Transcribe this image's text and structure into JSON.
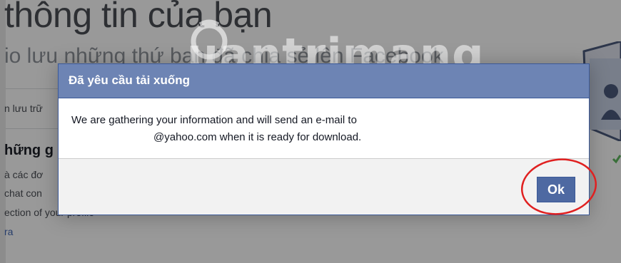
{
  "background": {
    "title": "thông tin của bạn",
    "subtitle": "io lưu những thứ bạn đã chia sẻ lên Facebook",
    "section_label": "n lưu trữ",
    "section_heading": "hững g",
    "lines": [
      "à các đơ",
      "chat con",
      "ection of your profile"
    ],
    "link": "ra"
  },
  "watermark": {
    "text": "uantrimang"
  },
  "dialog": {
    "title": "Đã yêu cầu tải xuống",
    "message_line1": "We are gathering your information and will send an e-mail to",
    "message_line2": "@yahoo.com when it is ready for download.",
    "ok_label": "Ok"
  },
  "colors": {
    "header": "#6d84b4",
    "button": "#4e69a2",
    "highlight": "#e02020",
    "link": "#4267b2"
  }
}
